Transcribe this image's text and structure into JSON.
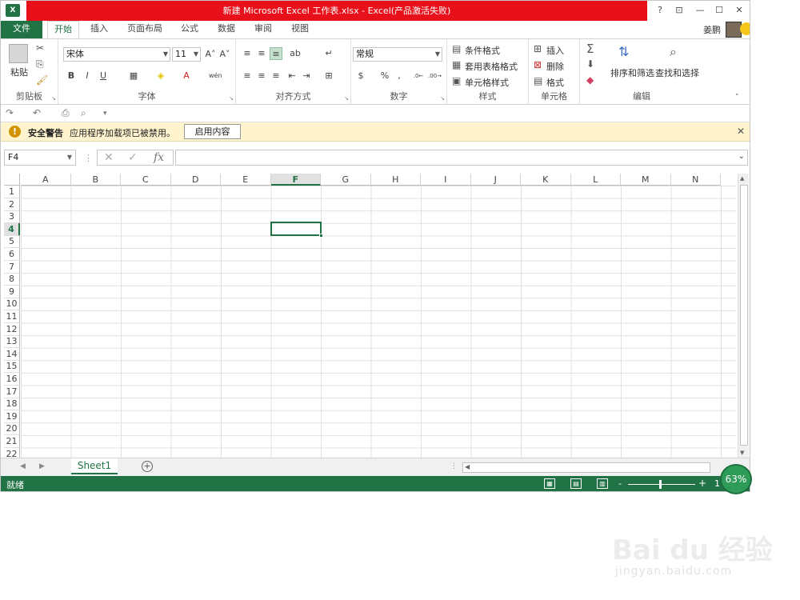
{
  "window": {
    "title": "新建 Microsoft Excel 工作表.xlsx -  Excel(产品激活失败)",
    "help": "?",
    "restore_ribbon": "⊡",
    "minimize": "—",
    "maximize": "☐",
    "close": "✕"
  },
  "tabs": {
    "file": "文件",
    "items": [
      "开始",
      "插入",
      "页面布局",
      "公式",
      "数据",
      "审阅",
      "视图"
    ],
    "user": "姜鹏"
  },
  "ribbon": {
    "clipboard": {
      "paste": "粘贴",
      "label": "剪贴板"
    },
    "font": {
      "name": "宋体",
      "size": "11",
      "label": "字体",
      "bold": "B",
      "italic": "I",
      "underline": "U"
    },
    "alignment": {
      "label": "对齐方式"
    },
    "number": {
      "format": "常规",
      "label": "数字",
      "percent": "%",
      "comma": ","
    },
    "styles": {
      "conditional": "条件格式",
      "table": "套用表格格式",
      "cell": "单元格样式",
      "label": "样式"
    },
    "cells": {
      "insert": "插入",
      "delete": "删除",
      "format": "格式",
      "label": "单元格"
    },
    "editing": {
      "sort": "排序和筛选",
      "find": "查找和选择",
      "label": "编辑"
    }
  },
  "warning": {
    "title": "安全警告",
    "message": "应用程序加载项已被禁用。",
    "button": "启用内容"
  },
  "formula_bar": {
    "name_box": "F4",
    "fx": "fx"
  },
  "grid": {
    "columns": [
      "A",
      "B",
      "C",
      "D",
      "E",
      "F",
      "G",
      "H",
      "I",
      "J",
      "K",
      "L",
      "M",
      "N"
    ],
    "selected_column": "F",
    "rows": [
      "1",
      "2",
      "3",
      "4",
      "5",
      "6",
      "7",
      "8",
      "9",
      "10",
      "11",
      "12",
      "13",
      "14",
      "15",
      "16",
      "17",
      "18",
      "19",
      "20",
      "21",
      "22"
    ],
    "selected_row": "4"
  },
  "sheets": {
    "tab": "Sheet1"
  },
  "status": {
    "ready": "就绪",
    "zoom_minus": "-",
    "zoom_plus": "+",
    "zoom_partial": "1",
    "zoom_badge": "63%"
  },
  "watermark": {
    "brand": "Bai du 经验",
    "url": "jingyan.baidu.com"
  },
  "colors": {
    "accent": "#217346",
    "title_bar": "#e8101a",
    "warning_bg": "#fff4ce"
  }
}
